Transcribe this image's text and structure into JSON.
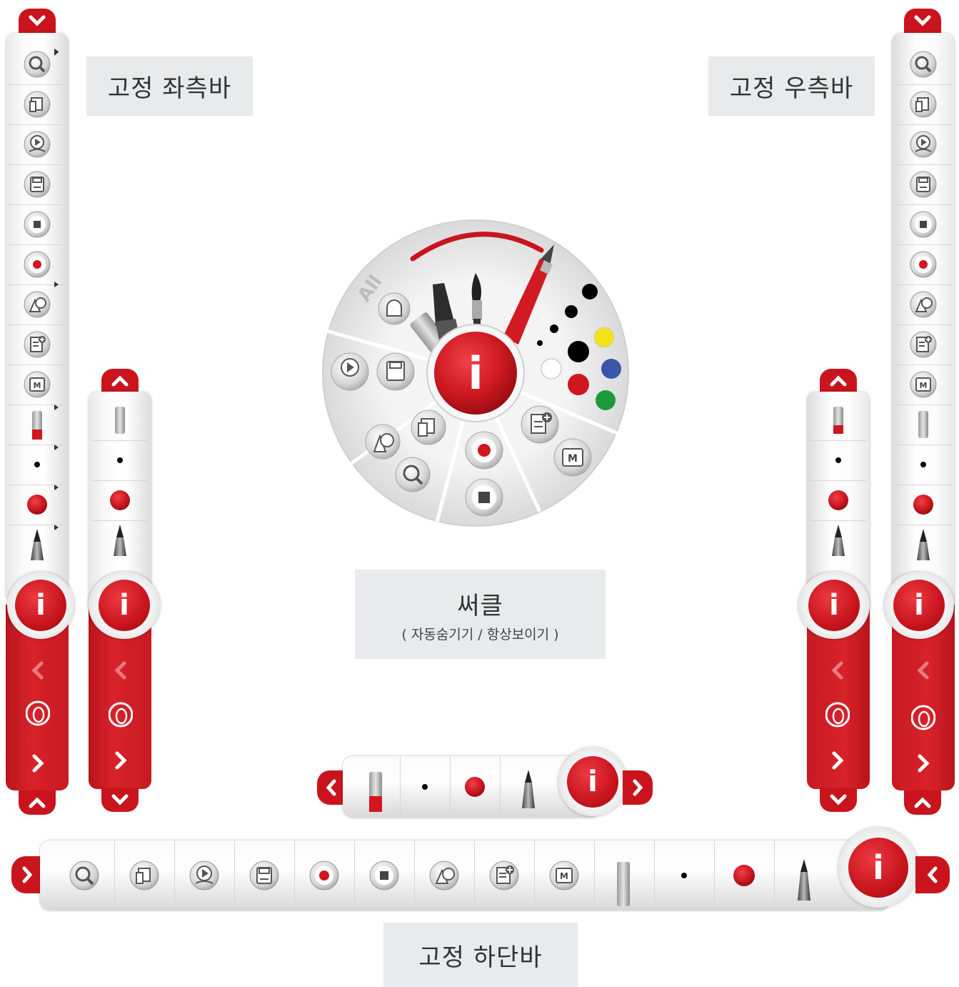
{
  "captions": {
    "left_bar": "고정 좌측바",
    "right_bar": "고정 우측바",
    "circle_main": "써클",
    "circle_sub": "( 자동숨기기 / 항상보이기 )",
    "bottom_bar": "고정 하단바"
  },
  "circle_menu": {
    "all_label": "All",
    "center_label": "i"
  },
  "toolbar": {
    "info_label": "i",
    "memo_label": "M",
    "tools": [
      "zoom-icon",
      "folder-icon",
      "play-icon",
      "save-icon",
      "stop-icon",
      "record-icon",
      "shape-icon",
      "add-page-icon",
      "memo-icon"
    ],
    "pen_tools": [
      "eraser-icon",
      "small-dot-icon",
      "red-dot-icon",
      "pen-icon"
    ]
  },
  "colors": {
    "brand_red": "#c9141e",
    "black": "#000000",
    "yellow": "#f2e21a",
    "blue": "#3c55a8",
    "green": "#1a9a3a",
    "white": "#ffffff"
  }
}
